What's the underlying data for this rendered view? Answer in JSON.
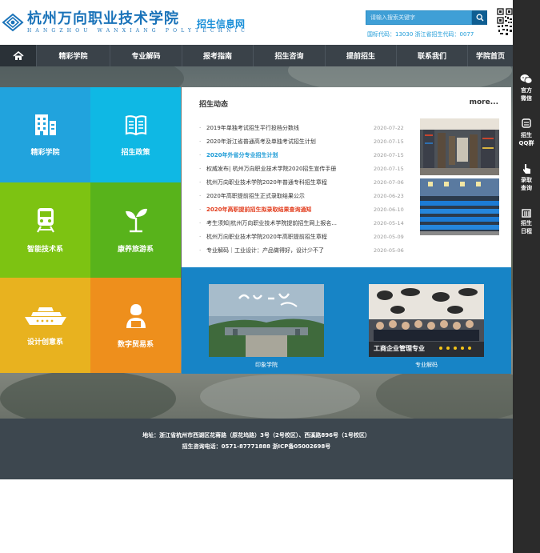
{
  "header": {
    "logo_cn": "杭州万向职业技术学院",
    "logo_en": "HANGZHOU WANXIANG POLYTECHNIC",
    "site_name": "招生信息网",
    "search_placeholder": "请输入搜索关键字",
    "codes": "国标代码：13030 浙江省招生代码：0077"
  },
  "nav": {
    "items": [
      "精彩学院",
      "专业解码",
      "报考指南",
      "招生咨询",
      "提前招生",
      "联系我们",
      "学院首页"
    ]
  },
  "tiles": [
    {
      "label": "精彩学院",
      "icon": "building-icon"
    },
    {
      "label": "招生政策",
      "icon": "book-icon"
    },
    {
      "label": "智能技术系",
      "icon": "train-icon"
    },
    {
      "label": "康养旅游系",
      "icon": "sprout-icon"
    },
    {
      "label": "设计创意系",
      "icon": "ship-icon"
    },
    {
      "label": "数字贸易系",
      "icon": "person-icon"
    }
  ],
  "news": {
    "heading": "招生动态",
    "more": "more...",
    "items": [
      {
        "title": "2019年单独考试招生平行投档分数线",
        "date": "2020-07-22"
      },
      {
        "title": "2020年浙江省普通高考及单独考试招生计划",
        "date": "2020-07-15"
      },
      {
        "title": "2020年外省分专业招生计划",
        "date": "2020-07-15"
      },
      {
        "title": "权威发布| 杭州万向职业技术学院2020招生宣传手册",
        "date": "2020-07-15"
      },
      {
        "title": "杭州万向职业技术学院2020年普通专科招生章程",
        "date": "2020-07-06"
      },
      {
        "title": "2020年高职提前招生正式录取结果公示",
        "date": "2020-06-23"
      },
      {
        "title": "2020年高职提前招生拟录取结果查询通知",
        "date": "2020-06-10"
      },
      {
        "title": "考生须知|杭州万向职业技术学院提前招生网上报名...",
        "date": "2020-05-14"
      },
      {
        "title": "杭州万向职业技术学院2020年高职提前招生章程",
        "date": "2020-05-09"
      },
      {
        "title": "专业解码｜工业设计：产品做得好，设计少不了",
        "date": "2020-05-06"
      }
    ]
  },
  "feature": {
    "left_caption": "印象学院",
    "right_caption": "专业解码",
    "right_overlay": "工商企业管理专业",
    "slider_dots": 5
  },
  "footer": {
    "address": "地址：浙江省杭州市西湖区花蒋路（原花坞路）3号（2号校区）、西溪路896号（1号校区）",
    "contact": "招生咨询电话：0571-87771888 浙ICP备05002698号"
  },
  "sidebar": [
    {
      "label": "官方微信",
      "icon": "wechat-icon"
    },
    {
      "label": "招生QQ群",
      "icon": "qq-icon"
    },
    {
      "label": "录取查询",
      "icon": "pointer-icon"
    },
    {
      "label": "招生日程",
      "icon": "calendar-icon"
    }
  ],
  "colors": {
    "brand_blue": "#1a73b9",
    "tile_sky": "#21a3dd",
    "tile_cyan": "#0fb8e4",
    "tile_lime": "#7dc312",
    "tile_green": "#58b31b",
    "tile_amber": "#e8b21f",
    "tile_orange": "#ee8f1c",
    "feature_blue": "#1784c6",
    "nav_dark": "#3a4249",
    "footer_dark": "#3d474f"
  }
}
